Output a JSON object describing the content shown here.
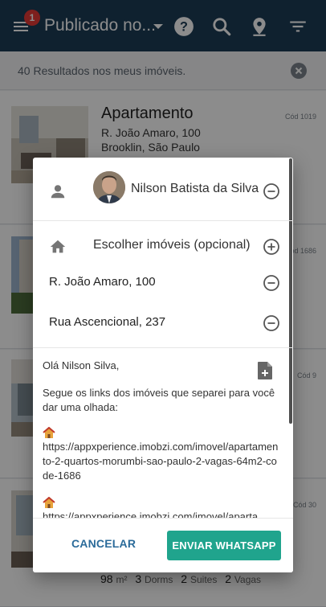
{
  "appbar": {
    "notification_count": "1",
    "title": "Publicado no...",
    "icons": [
      "menu-icon",
      "chevron-down-icon",
      "help-icon",
      "search-icon",
      "location-pin-icon",
      "filter-icon"
    ]
  },
  "results": {
    "text": "40 Resultados nos meus imóveis."
  },
  "listings": [
    {
      "type": "Apartamento",
      "street": "R. João Amaro, 100",
      "district": "Brooklin, São Paulo",
      "code": "Cód 1019"
    },
    {
      "code": "Cód 1686"
    },
    {
      "code": "Cód 9"
    },
    {
      "code": "Cód 30",
      "features": {
        "area": "98",
        "area_unit": "m²",
        "dorms": "3",
        "dorms_label": "Dorms",
        "suites": "2",
        "suites_label": "Suites",
        "vagas": "2",
        "vagas_label": "Vagas"
      }
    }
  ],
  "modal": {
    "user_name": "Nilson Batista da Silva",
    "choose_label": "Escolher imóveis (opcional)",
    "selected_properties": [
      "R. João Amaro, 100",
      "Rua Ascencional, 237"
    ],
    "message": {
      "greeting": "Olá Nilson Silva,",
      "intro": "Segue os links dos imóveis que separei para você dar uma olhada:",
      "link1": "https://appxperience.imobzi.com/imovel/apartamento-2-quartos-morumbi-sao-paulo-2-vagas-64m2-code-1686",
      "link2": "https://appxperience.imobzi.com/imovel/aparta"
    },
    "cancel_label": "CANCELAR",
    "send_label": "ENVIAR WHATSAPP"
  },
  "colors": {
    "appbar": "#1d3c57",
    "badge": "#e53935",
    "send_button": "#20a48d",
    "cancel_text": "#2b6b9a"
  }
}
